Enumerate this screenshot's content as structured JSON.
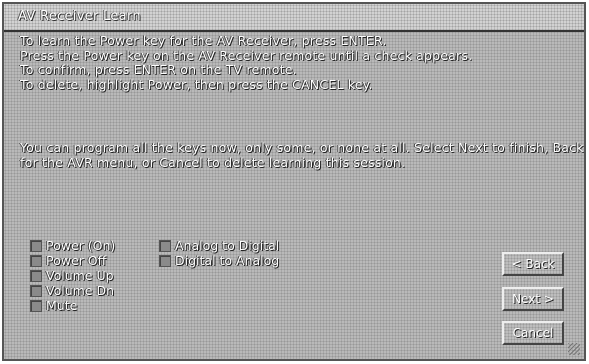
{
  "window": {
    "title": "AV Receiver Learn"
  },
  "instructions": {
    "lines": [
      "To learn the Power key for the AV Receiver, press ENTER.",
      "Press the Power key on the AV Receiver remote until a check appears.",
      "To confirm, press ENTER on the TV remote.",
      "To delete, highlight Power, then press the CANCEL key."
    ],
    "paragraph": "You can program all the keys now, only some, or none at all. Select Next to finish, Back for the AVR menu, or Cancel to delete learning this session."
  },
  "keys": {
    "column1": [
      "Power (On)",
      "Power Off",
      "Volume Up",
      "Volume Dn",
      "Mute"
    ],
    "column2": [
      "Analog to Digital",
      "Digital to Analog"
    ]
  },
  "buttons": {
    "back": "< Back",
    "next": "Next >",
    "cancel": "Cancel"
  }
}
